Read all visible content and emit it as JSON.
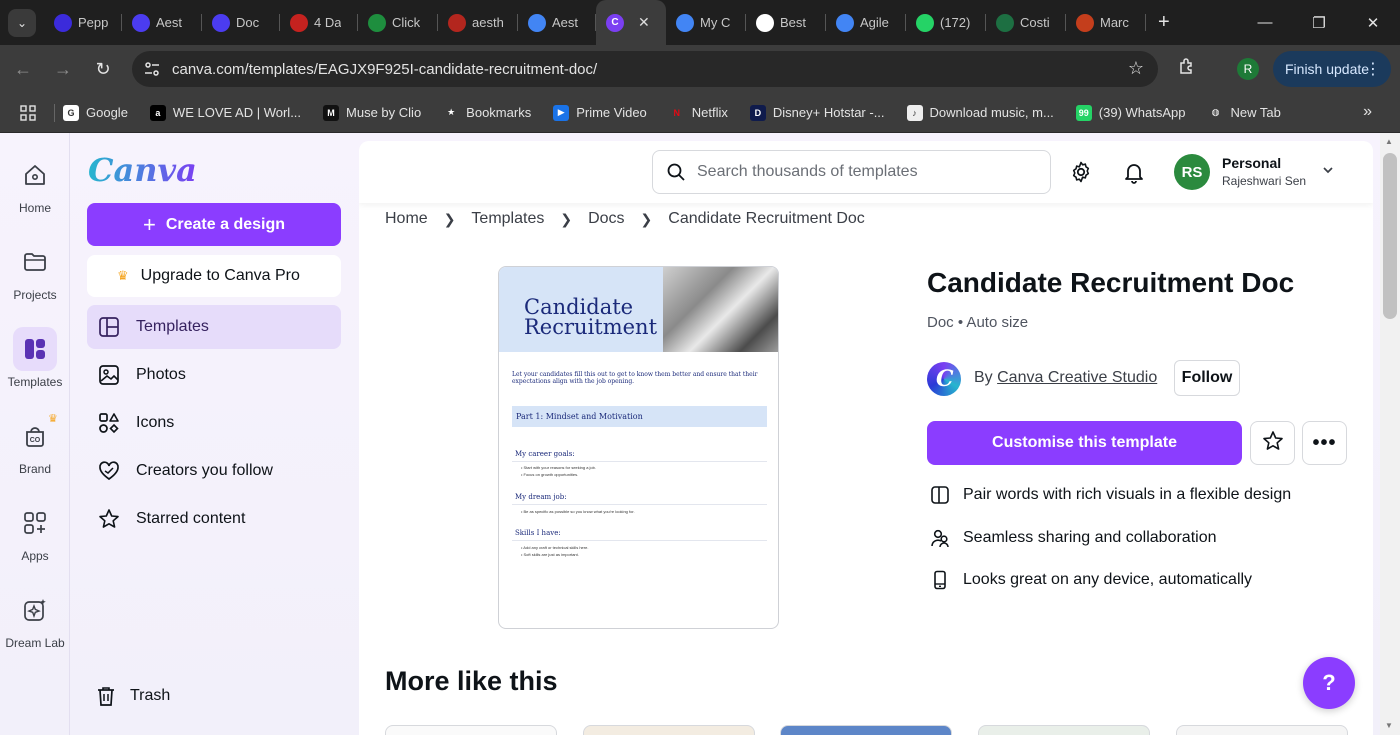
{
  "browser": {
    "tabs": [
      {
        "label": "Pepp",
        "icon": "peppertype-icon",
        "color": "#3b2bdb"
      },
      {
        "label": "Aest",
        "icon": "aesthetic-icon",
        "color": "#4b3cf0"
      },
      {
        "label": "Doc",
        "icon": "doc-app-icon",
        "color": "#4b3cf0"
      },
      {
        "label": "4 Da",
        "icon": "gmail-icon",
        "color": "#c5221f"
      },
      {
        "label": "Click",
        "icon": "clickup-check-icon",
        "color": "#1e8e3e"
      },
      {
        "label": "aesth",
        "icon": "aesthetic-target-icon",
        "color": "#b3261e"
      },
      {
        "label": "Aest",
        "icon": "google-docs-icon",
        "color": "#4285f4"
      },
      {
        "label": "",
        "icon": "canva-icon",
        "color": "#7b3ff2",
        "active": true
      },
      {
        "label": "My C",
        "icon": "google-docs-icon",
        "color": "#4285f4"
      },
      {
        "label": "Best",
        "icon": "openai-icon",
        "color": "#ffffff"
      },
      {
        "label": "Agile",
        "icon": "google-docs-icon",
        "color": "#4285f4"
      },
      {
        "label": "(172)",
        "icon": "whatsapp-icon",
        "color": "#25d366"
      },
      {
        "label": "Costi",
        "icon": "excel-icon",
        "color": "#1d6f42"
      },
      {
        "label": "Marc",
        "icon": "powerpoint-icon",
        "color": "#c43e1c"
      }
    ],
    "active_tab_favicon_text": "C",
    "url": "canva.com/templates/EAGJX9F925I-candidate-recruitment-doc/",
    "profile_initial": "R",
    "finish_update": "Finish update",
    "bookmarks": [
      {
        "label": "Google",
        "icon": "google-icon",
        "color": "#ffffff",
        "glyph": "G"
      },
      {
        "label": "WE LOVE AD | Worl...",
        "icon": "weloveadd-icon",
        "color": "#000000",
        "glyph": "a"
      },
      {
        "label": "Muse by Clio",
        "icon": "muse-icon",
        "color": "#111111",
        "glyph": "M"
      },
      {
        "label": "Bookmarks",
        "icon": "star-icon",
        "color": "transparent",
        "glyph": "★"
      },
      {
        "label": "Prime Video",
        "icon": "prime-video-icon",
        "color": "#1a73e8",
        "glyph": "▶"
      },
      {
        "label": "Netflix",
        "icon": "netflix-icon",
        "color": "transparent",
        "glyph": "N"
      },
      {
        "label": "Disney+ Hotstar -...",
        "icon": "hotstar-icon",
        "color": "#0f1b4c",
        "glyph": "D"
      },
      {
        "label": "Download music, m...",
        "icon": "music-download-icon",
        "color": "#eeeeee",
        "glyph": "♪"
      },
      {
        "label": "(39) WhatsApp",
        "icon": "whatsapp-icon",
        "color": "#25d366",
        "glyph": "99"
      },
      {
        "label": "New Tab",
        "icon": "globe-icon",
        "color": "transparent",
        "glyph": "◍"
      }
    ]
  },
  "rail": {
    "items": [
      {
        "label": "Home",
        "icon": "home-icon"
      },
      {
        "label": "Projects",
        "icon": "folder-icon"
      },
      {
        "label": "Templates",
        "icon": "templates-icon",
        "active": true
      },
      {
        "label": "Brand",
        "icon": "brand-icon"
      },
      {
        "label": "Apps",
        "icon": "apps-icon"
      },
      {
        "label": "Dream Lab",
        "icon": "dream-lab-icon"
      }
    ]
  },
  "sidebar": {
    "logo": "Canva",
    "create_label": "Create a design",
    "upgrade_label": "Upgrade to Canva Pro",
    "items": [
      {
        "label": "Templates",
        "icon": "templates-outline-icon",
        "active": true
      },
      {
        "label": "Photos",
        "icon": "photos-icon"
      },
      {
        "label": "Icons",
        "icon": "shapes-icon"
      },
      {
        "label": "Creators you follow",
        "icon": "heart-icon"
      },
      {
        "label": "Starred content",
        "icon": "star-outline-icon"
      }
    ],
    "trash_label": "Trash"
  },
  "topbar": {
    "search_placeholder": "Search thousands of templates",
    "avatar_initials": "RS",
    "account_type": "Personal",
    "account_name": "Rajeshwari Sen"
  },
  "breadcrumb": [
    "Home",
    "Templates",
    "Docs",
    "Candidate Recruitment Doc"
  ],
  "template": {
    "title": "Candidate Recruitment Doc",
    "meta": "Doc • Auto size",
    "by_label": "By",
    "creator": "Canva Creative Studio",
    "follow_label": "Follow",
    "customise_label": "Customise this template",
    "features": [
      {
        "text": "Pair words with rich visuals in a flexible design",
        "icon": "layout-icon"
      },
      {
        "text": "Seamless sharing and collaboration",
        "icon": "people-icon"
      },
      {
        "text": "Looks great on any device, automatically",
        "icon": "mobile-icon"
      }
    ],
    "preview": {
      "title_line1": "Candidate",
      "title_line2": "Recruitment",
      "intro": "Let your candidates fill this out to get to know them better and ensure that their expectations align with the job opening.",
      "part": "Part 1: Mindset and Motivation",
      "sections": [
        {
          "heading": "My career goals:",
          "bullets": [
            "Start with your reasons for seeking a job.",
            "Focus on growth opportunities."
          ]
        },
        {
          "heading": "My dream job:",
          "bullets": [
            "Be as specific as possible so you know what you're looking for."
          ]
        },
        {
          "heading": "Skills I have:",
          "bullets": [
            "Add any craft or technical skills here.",
            "Soft skills are just as important."
          ]
        }
      ]
    }
  },
  "more_title": "More like this",
  "help_label": "?"
}
